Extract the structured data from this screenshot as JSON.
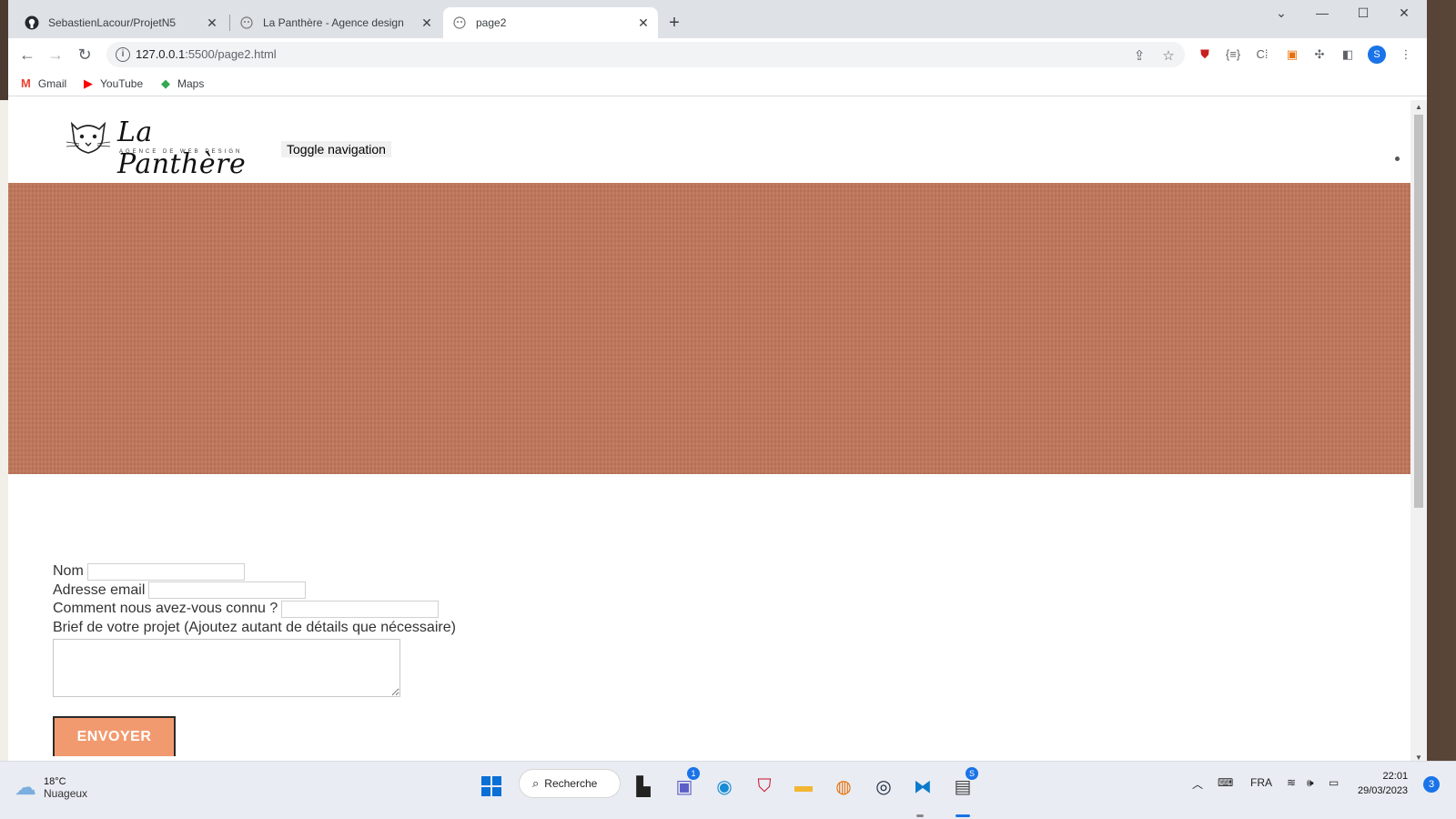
{
  "browser": {
    "tabs": [
      {
        "title": "SebastienLacour/ProjetN5",
        "icon": "github-icon"
      },
      {
        "title": "La Panthère - Agence design",
        "icon": "panther-icon"
      },
      {
        "title": "page2",
        "icon": "panther-icon"
      }
    ],
    "url_host": "127.0.0.1",
    "url_rest": ":5500/page2.html",
    "profile_initial": "S",
    "bookmarks": [
      {
        "label": "Gmail",
        "icon": "gmail-icon"
      },
      {
        "label": "YouTube",
        "icon": "youtube-icon"
      },
      {
        "label": "Maps",
        "icon": "maps-icon"
      }
    ]
  },
  "page": {
    "logo_title": "La Panthère",
    "logo_subtitle": "AGENCE DE WEB DESIGN",
    "toggle_nav": "Toggle navigation",
    "hero_color": "#c0775a",
    "form": {
      "name_label": "Nom",
      "email_label": "Adresse email",
      "source_label": "Comment nous avez-vous connu ?",
      "brief_label": "Brief de votre projet (Ajoutez autant de détails que nécessaire)",
      "submit_label": "ENVOYER"
    }
  },
  "taskbar": {
    "weather_temp": "18°C",
    "weather_desc": "Nuageux",
    "search_label": "Recherche",
    "teams_badge": "1",
    "notepad_badge": "S",
    "language": "FRA",
    "time": "22:01",
    "date": "29/03/2023",
    "notifications": "3"
  }
}
